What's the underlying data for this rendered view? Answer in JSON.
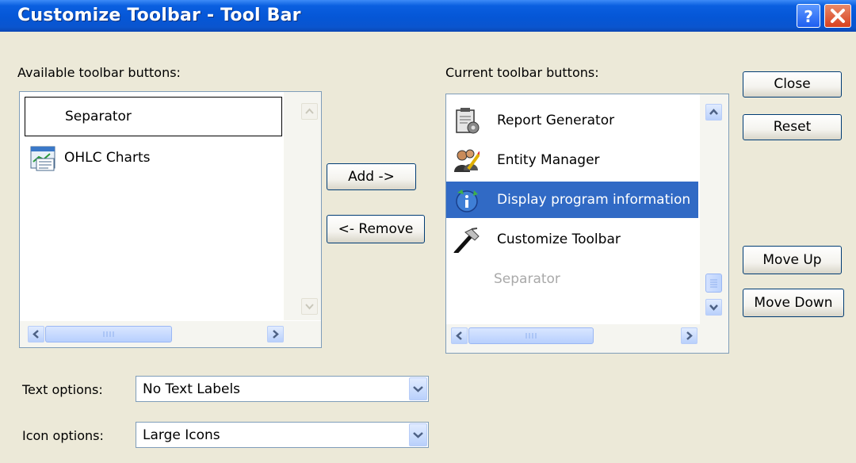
{
  "window": {
    "title": "Customize Toolbar - Tool Bar",
    "help_label": "?",
    "close_label": "×"
  },
  "available": {
    "label": "Available toolbar buttons:",
    "items": [
      {
        "label": "Separator",
        "icon": "none",
        "selected": false,
        "focused": true,
        "disabled": false
      },
      {
        "label": "OHLC Charts",
        "icon": "ohlc-chart-icon",
        "selected": false,
        "focused": false,
        "disabled": false
      }
    ]
  },
  "current": {
    "label": "Current toolbar buttons:",
    "items": [
      {
        "label": "Report Generator",
        "icon": "report-generator-icon",
        "selected": false,
        "disabled": false
      },
      {
        "label": "Entity Manager",
        "icon": "entity-manager-icon",
        "selected": false,
        "disabled": false
      },
      {
        "label": "Display program information",
        "icon": "program-info-icon",
        "selected": true,
        "disabled": false
      },
      {
        "label": "Customize Toolbar",
        "icon": "hammer-icon",
        "selected": false,
        "disabled": false
      },
      {
        "label": "Separator",
        "icon": "none",
        "selected": false,
        "disabled": true
      }
    ]
  },
  "buttons": {
    "add": "Add ->",
    "remove": "<- Remove",
    "close": "Close",
    "reset": "Reset",
    "move_up": "Move Up",
    "move_down": "Move Down"
  },
  "options": {
    "text_label": "Text options:",
    "text_value": "No Text Labels",
    "icon_label": "Icon options:",
    "icon_value": "Large Icons"
  },
  "colors": {
    "titlebar": "#0556d6",
    "selection": "#316ac5",
    "face": "#ece9d8"
  }
}
